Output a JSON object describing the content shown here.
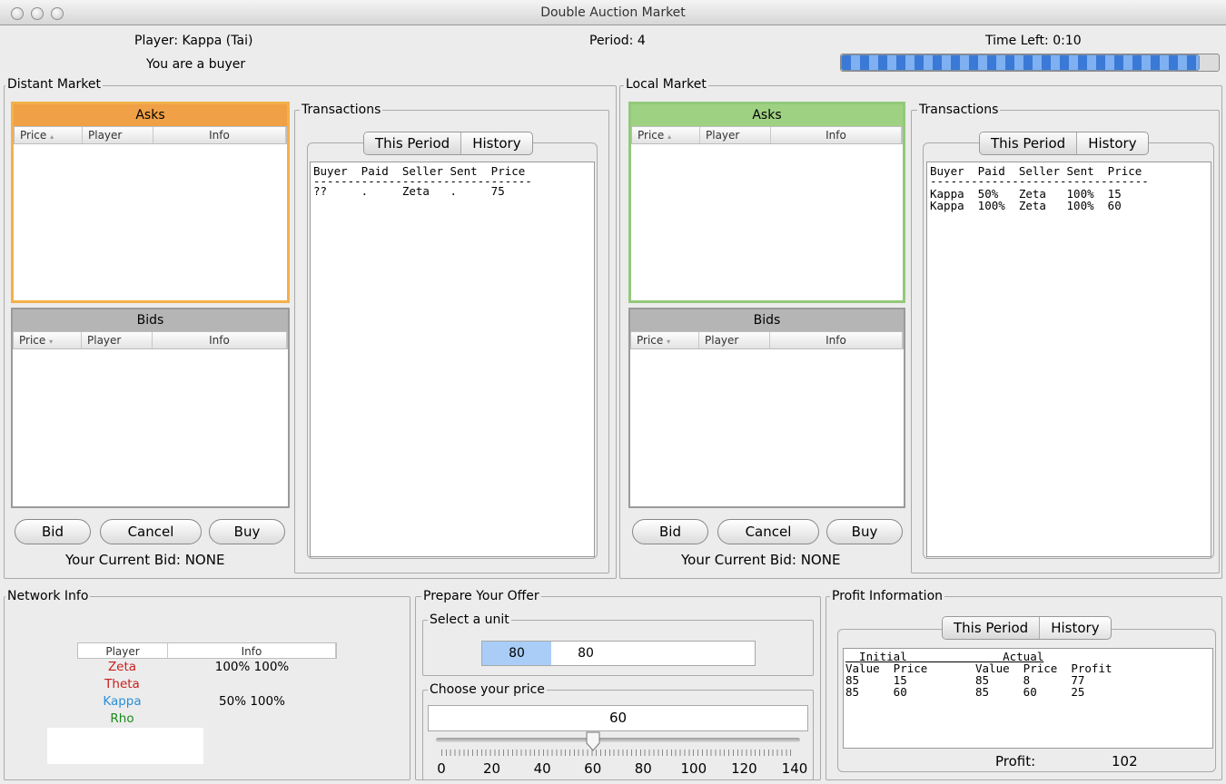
{
  "window": {
    "title": "Double Auction Market"
  },
  "header": {
    "player": "Player: Kappa (Tai)",
    "role": "You are a buyer",
    "period": "Period: 4",
    "time_left": "Time Left: 0:10"
  },
  "distant": {
    "label": "Distant Market",
    "asks_title": "Asks",
    "bids_title": "Bids",
    "col_price_asks": "Price",
    "col_price_bids": "Price",
    "col_player": "Player",
    "col_info": "Info",
    "buttons": {
      "bid": "Bid",
      "cancel": "Cancel",
      "buy": "Buy"
    },
    "current_bid": "Your Current Bid:  NONE",
    "transactions": {
      "label": "Transactions",
      "tab_period": "This Period",
      "tab_history": "History",
      "header": "Buyer  Paid  Seller Sent  Price",
      "divider": "--------------------------------",
      "rows": [
        "??     .     Zeta   .     75"
      ]
    }
  },
  "local": {
    "label": "Local Market",
    "asks_title": "Asks",
    "bids_title": "Bids",
    "col_price_asks": "Price",
    "col_price_bids": "Price",
    "col_player": "Player",
    "col_info": "Info",
    "buttons": {
      "bid": "Bid",
      "cancel": "Cancel",
      "buy": "Buy"
    },
    "current_bid": "Your Current Bid:  NONE",
    "transactions": {
      "label": "Transactions",
      "tab_period": "This Period",
      "tab_history": "History",
      "header": "Buyer  Paid  Seller Sent  Price",
      "divider": "--------------------------------",
      "rows": [
        "Kappa  50%   Zeta   100%  15",
        "Kappa  100%  Zeta   100%  60"
      ]
    }
  },
  "network": {
    "label": "Network Info",
    "col_player": "Player",
    "col_info": "Info",
    "rows": [
      {
        "player": "Zeta",
        "info": "100% 100%",
        "color": "#c81e1e"
      },
      {
        "player": "Theta",
        "info": "",
        "color": "#c81e1e"
      },
      {
        "player": "Kappa",
        "info": "50% 100%",
        "color": "#2a8fd6"
      },
      {
        "player": "Rho",
        "info": "",
        "color": "#1e8a1e"
      }
    ]
  },
  "offer": {
    "label": "Prepare Your Offer",
    "unit_label": "Select a unit",
    "units": [
      "80",
      "80"
    ],
    "price_label": "Choose your price",
    "price_value": "60",
    "slider_value": 60,
    "slider_ticks": [
      "0",
      "20",
      "40",
      "60",
      "80",
      "100",
      "120",
      "140"
    ]
  },
  "profit": {
    "label": "Profit Information",
    "tab_period": "This Period",
    "tab_history": "History",
    "lines": [
      "  Initial              Actual",
      "Value  Price       Value  Price  Profit",
      "85     15          85     8      77",
      "85     60          85     60     25"
    ],
    "total_label": "Profit:",
    "total_value": "102"
  },
  "time_progress": 0.95
}
